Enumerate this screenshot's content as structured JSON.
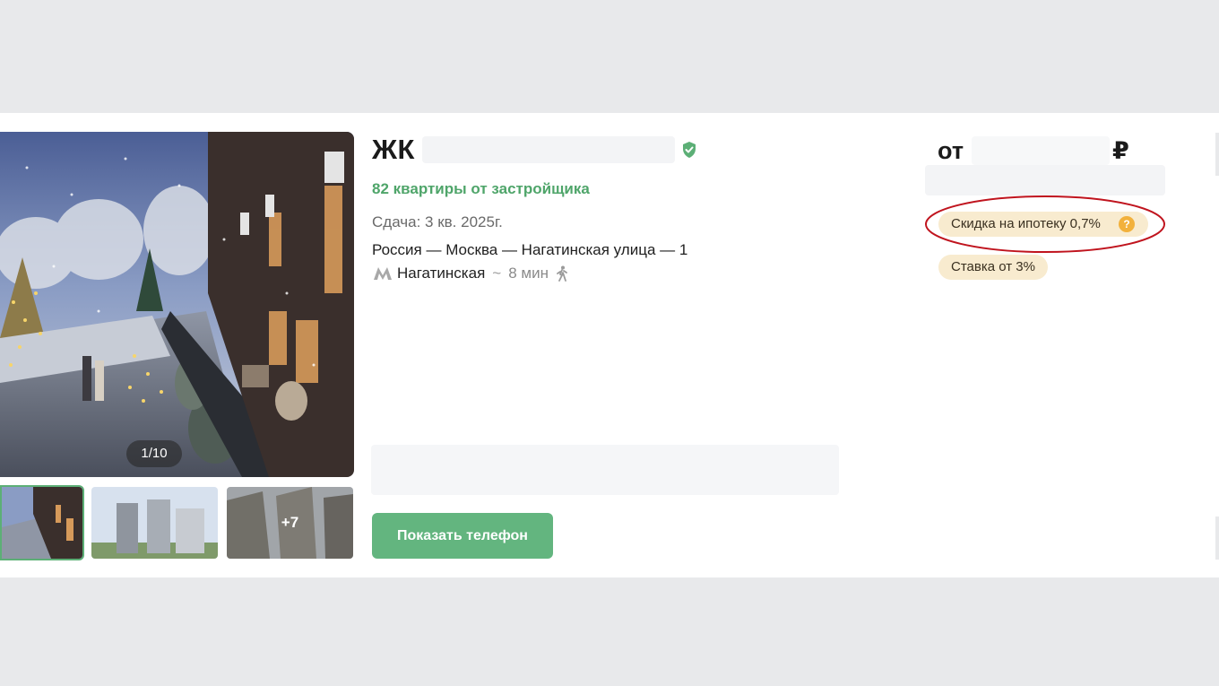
{
  "listing": {
    "title_prefix": "ЖК",
    "apartments_text": "82 квартиры от застройщика",
    "delivery_text": "Сдача: 3 кв. 2025г.",
    "address_text": "Россия — Москва — Нагатинская улица — 1",
    "metro": {
      "station": "Нагатинская",
      "separator": "~",
      "time": "8 мин",
      "metro_icon": "metro-m-icon",
      "walk_icon": "walking-person-icon"
    },
    "verified_icon": "shield-check-icon"
  },
  "gallery": {
    "counter": "1/10",
    "more_count": "+7"
  },
  "actions": {
    "show_phone_label": "Показать телефон"
  },
  "price": {
    "prefix": "от",
    "currency": "₽"
  },
  "badges": {
    "discount_label": "Скидка на ипотеку 0,7%",
    "discount_help": "?",
    "rate_label": "Ставка от 3%"
  },
  "colors": {
    "accent_green": "#63b57f",
    "badge_bg": "#f8ebcf",
    "help_icon": "#f2b13c",
    "highlight_ring": "#c0141e"
  }
}
